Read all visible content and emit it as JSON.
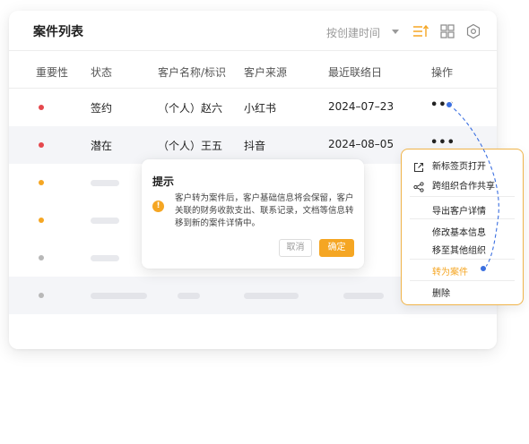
{
  "card": {
    "title": "案件列表",
    "sort_select": "按创建时间",
    "toolbar_icons": [
      "sort-lines-icon",
      "grid-icon",
      "gear-icon"
    ]
  },
  "table": {
    "headers": [
      "重要性",
      "状态",
      "客户名称/标识",
      "客户来源",
      "最近联络日",
      "操作"
    ],
    "rows": [
      {
        "priority_color": "#e5484d",
        "status": "签约",
        "customer": "（个人）赵六",
        "source": "小红书",
        "last_contact": "2024–07–23",
        "action": "•••"
      },
      {
        "priority_color": "#e5484d",
        "status": "潜在",
        "customer": "（个人）王五",
        "source": "抖音",
        "last_contact": "2024–08–05",
        "action": "•••"
      },
      {
        "priority_color": "#f5a623"
      },
      {
        "priority_color": "#f5a623"
      },
      {
        "priority_color": "#b8b8b8"
      },
      {
        "priority_color": "#b8b8b8"
      }
    ]
  },
  "dialog": {
    "title": "提示",
    "message": "客户转为案件后，客户基础信息将会保留，客户关联的财务收款支出、联系记录，文档等信息转移到新的案件详情中。",
    "cancel": "取消",
    "ok": "确定"
  },
  "menu": {
    "items": [
      {
        "label": "新标签页打开",
        "icon": "open-new-tab-icon"
      },
      {
        "label": "跨组织合作共享",
        "icon": "share-icon"
      },
      {
        "label": "导出客户详情"
      },
      {
        "label": "修改基本信息"
      },
      {
        "label": "移至其他组织"
      },
      {
        "label": "转为案件",
        "active": true
      },
      {
        "label": "删除"
      }
    ]
  },
  "colors": {
    "accent": "#f5a623",
    "connector": "#3b6fe0",
    "priority_high": "#e5484d",
    "priority_mid": "#f5a623",
    "priority_low": "#b8b8b8"
  }
}
